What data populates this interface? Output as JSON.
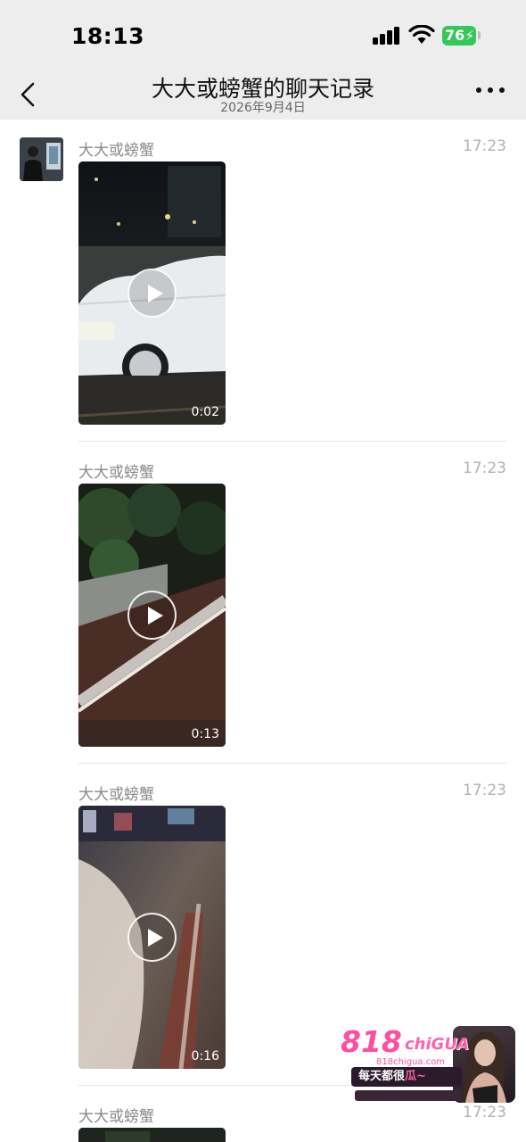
{
  "status_bar": {
    "time": "18:13",
    "battery": "76"
  },
  "nav": {
    "title": "大大或螃蟹的聊天记录",
    "subtitle": "2026年9月4日"
  },
  "messages": [
    {
      "sender": "大大或螃蟹",
      "time": "17:23",
      "duration": "0:02"
    },
    {
      "sender": "大大或螃蟹",
      "time": "17:23",
      "duration": "0:13"
    },
    {
      "sender": "大大或螃蟹",
      "time": "17:23",
      "duration": "0:16"
    },
    {
      "sender": "大大或螃蟹",
      "time": "17:23"
    }
  ],
  "watermark": {
    "brand_number": "818",
    "brand_word": "chiGUA",
    "domain": "818chigua.com",
    "slogan_prefix": "每天都很",
    "slogan_highlight": "瓜~"
  },
  "icons": [
    "back-arrow-icon",
    "more-dots-icon",
    "signal-icon",
    "wifi-icon",
    "battery-icon",
    "play-icon"
  ],
  "colors": {
    "header_bg": "#ededed",
    "battery_green": "#34c759",
    "watermark_pink": "#ff4fa3"
  }
}
